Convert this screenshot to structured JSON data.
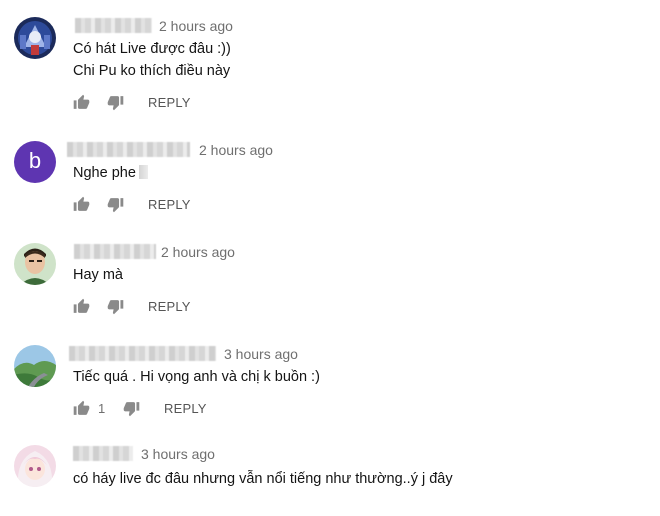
{
  "comments": [
    {
      "avatar": "robot-avatar",
      "time": "2 hours ago",
      "lines": [
        "Có hát Live được đâu :))",
        "Chi Pu ko thích điều này"
      ],
      "reply_label": "REPLY",
      "likes": ""
    },
    {
      "avatar": "letter-avatar",
      "avatar_letter": "b",
      "avatar_color": "#5e35b1",
      "time": "2 hours ago",
      "lines": [
        "Nghe phe"
      ],
      "reply_label": "REPLY",
      "likes": ""
    },
    {
      "avatar": "person-avatar",
      "time": "2 hours ago",
      "lines": [
        "Hay mà"
      ],
      "reply_label": "REPLY",
      "likes": ""
    },
    {
      "avatar": "landscape-avatar",
      "time": "3 hours ago",
      "lines": [
        "Tiếc quá . Hi vọng anh và chị k buồn :)"
      ],
      "reply_label": "REPLY",
      "likes": "1"
    },
    {
      "avatar": "anime-avatar",
      "time": "3 hours ago",
      "lines": [
        "có háy live đc đâu nhưng vẫn nổi tiếng như thường..ý j đây"
      ],
      "reply_label": "",
      "likes": ""
    }
  ],
  "icons": {
    "like": "thumb-up-icon",
    "dislike": "thumb-down-icon"
  },
  "colors": {
    "accent_letter_avatar": "#5e35b1",
    "meta_text": "#6f6f6f"
  }
}
